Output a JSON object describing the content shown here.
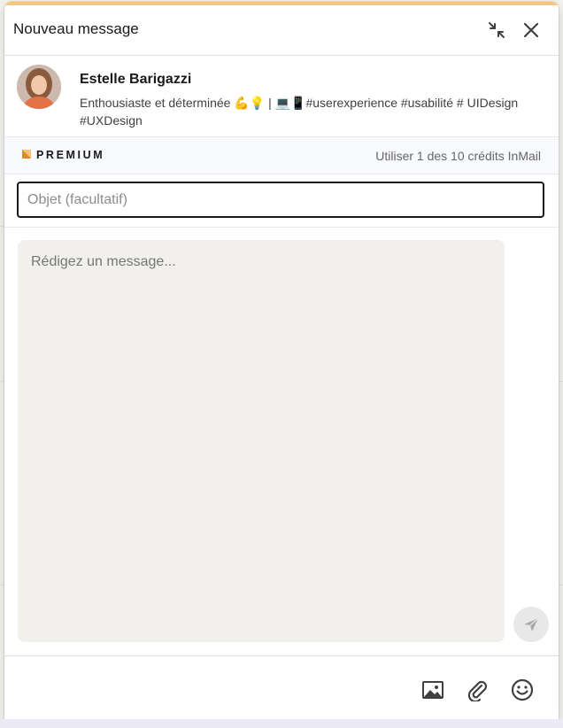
{
  "dialog": {
    "title": "Nouveau message",
    "minimize_icon": "collapse-arrows-icon",
    "close_icon": "close-x-icon",
    "accent_color": "#f8c77e"
  },
  "recipient": {
    "name": "Estelle Barigazzi",
    "headline": "Enthousiaste et déterminée 💪💡 | 💻📱#userexperience #usabilité # UIDesign #UXDesign"
  },
  "premium": {
    "label": "PREMIUM",
    "credits_text": "Utiliser 1 des 10 crédits InMail",
    "logo_color": "#e7a33e"
  },
  "subject": {
    "placeholder": "Objet (facultatif)",
    "value": ""
  },
  "message": {
    "placeholder": "Rédigez un message...",
    "value": ""
  },
  "toolbar": {
    "send_icon": "send-paper-plane-icon",
    "image_icon": "image-icon",
    "attach_icon": "paperclip-icon",
    "emoji_icon": "emoji-smile-icon"
  }
}
